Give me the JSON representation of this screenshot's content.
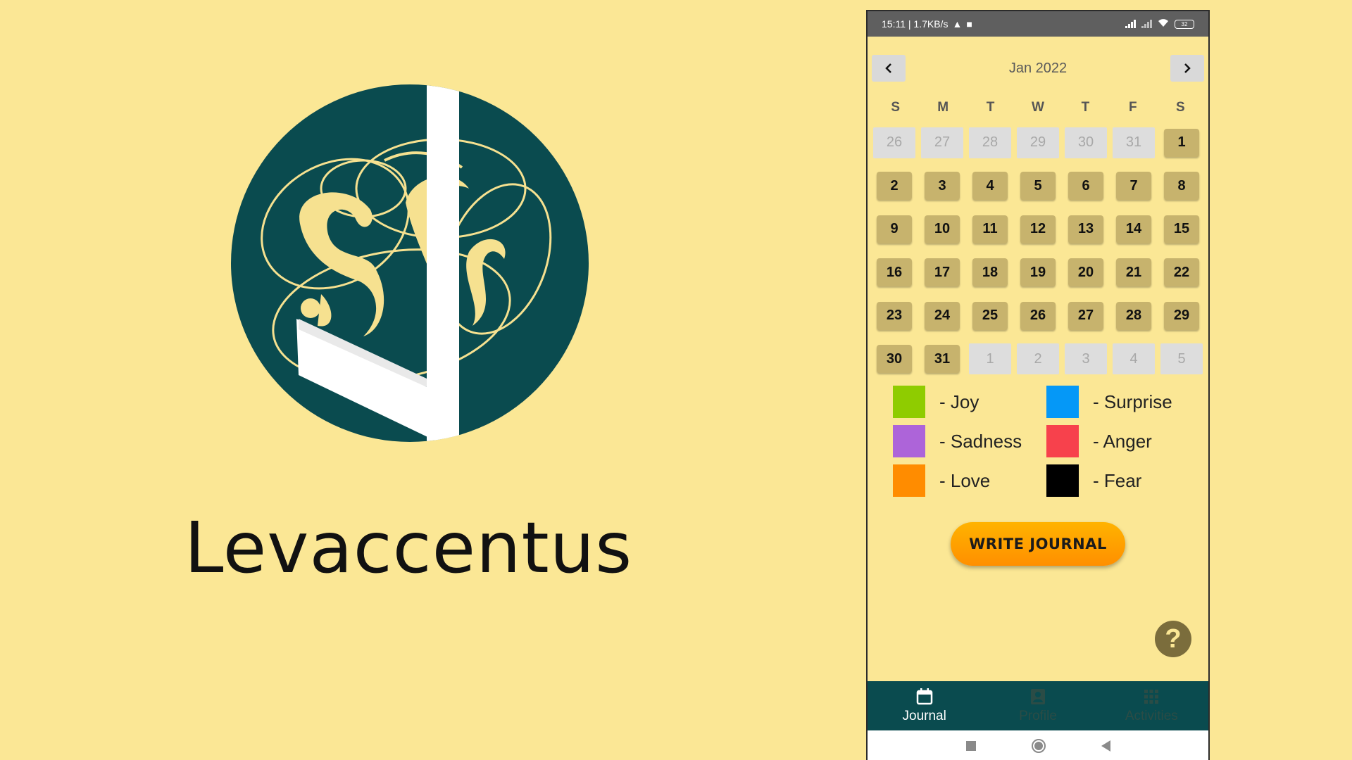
{
  "brand": {
    "name": "Levaccentus",
    "logo_icon": "levaccentus-logo"
  },
  "status_bar": {
    "time_speed": "15:11 | 1.7KB/s",
    "battery": "32"
  },
  "calendar": {
    "month_label": "Jan 2022",
    "prev_icon": "chevron-left-icon",
    "next_icon": "chevron-right-icon",
    "weekdays": [
      "S",
      "M",
      "T",
      "W",
      "T",
      "F",
      "S"
    ],
    "days": [
      {
        "n": "26",
        "current": false
      },
      {
        "n": "27",
        "current": false
      },
      {
        "n": "28",
        "current": false
      },
      {
        "n": "29",
        "current": false
      },
      {
        "n": "30",
        "current": false
      },
      {
        "n": "31",
        "current": false
      },
      {
        "n": "1",
        "current": true
      },
      {
        "n": "2",
        "current": true
      },
      {
        "n": "3",
        "current": true
      },
      {
        "n": "4",
        "current": true
      },
      {
        "n": "5",
        "current": true
      },
      {
        "n": "6",
        "current": true
      },
      {
        "n": "7",
        "current": true
      },
      {
        "n": "8",
        "current": true
      },
      {
        "n": "9",
        "current": true
      },
      {
        "n": "10",
        "current": true
      },
      {
        "n": "11",
        "current": true
      },
      {
        "n": "12",
        "current": true
      },
      {
        "n": "13",
        "current": true
      },
      {
        "n": "14",
        "current": true
      },
      {
        "n": "15",
        "current": true
      },
      {
        "n": "16",
        "current": true
      },
      {
        "n": "17",
        "current": true
      },
      {
        "n": "18",
        "current": true
      },
      {
        "n": "19",
        "current": true
      },
      {
        "n": "20",
        "current": true
      },
      {
        "n": "21",
        "current": true
      },
      {
        "n": "22",
        "current": true
      },
      {
        "n": "23",
        "current": true
      },
      {
        "n": "24",
        "current": true
      },
      {
        "n": "25",
        "current": true
      },
      {
        "n": "26",
        "current": true
      },
      {
        "n": "27",
        "current": true
      },
      {
        "n": "28",
        "current": true
      },
      {
        "n": "29",
        "current": true
      },
      {
        "n": "30",
        "current": true
      },
      {
        "n": "31",
        "current": true
      },
      {
        "n": "1",
        "current": false
      },
      {
        "n": "2",
        "current": false
      },
      {
        "n": "3",
        "current": false
      },
      {
        "n": "4",
        "current": false
      },
      {
        "n": "5",
        "current": false
      }
    ]
  },
  "legend": [
    {
      "label": "- Joy",
      "color": "#8fcc00"
    },
    {
      "label": "- Surprise",
      "color": "#0598f7"
    },
    {
      "label": "- Sadness",
      "color": "#ad64d9"
    },
    {
      "label": "- Anger",
      "color": "#f7414c"
    },
    {
      "label": "- Love",
      "color": "#ff8c00"
    },
    {
      "label": "- Fear",
      "color": "#000000"
    }
  ],
  "write_button": "WRITE JOURNAL",
  "help": {
    "icon": "help-icon",
    "glyph": "?"
  },
  "bottom_nav": [
    {
      "label": "Journal",
      "icon": "calendar-icon",
      "active": true
    },
    {
      "label": "Profile",
      "icon": "profile-icon",
      "active": false
    },
    {
      "label": "Activities",
      "icon": "grid-icon",
      "active": false
    }
  ],
  "colors": {
    "background": "#fbe795",
    "teal": "#0a4b4f",
    "day_active": "#c7b36d",
    "day_inactive": "#dddddd"
  }
}
